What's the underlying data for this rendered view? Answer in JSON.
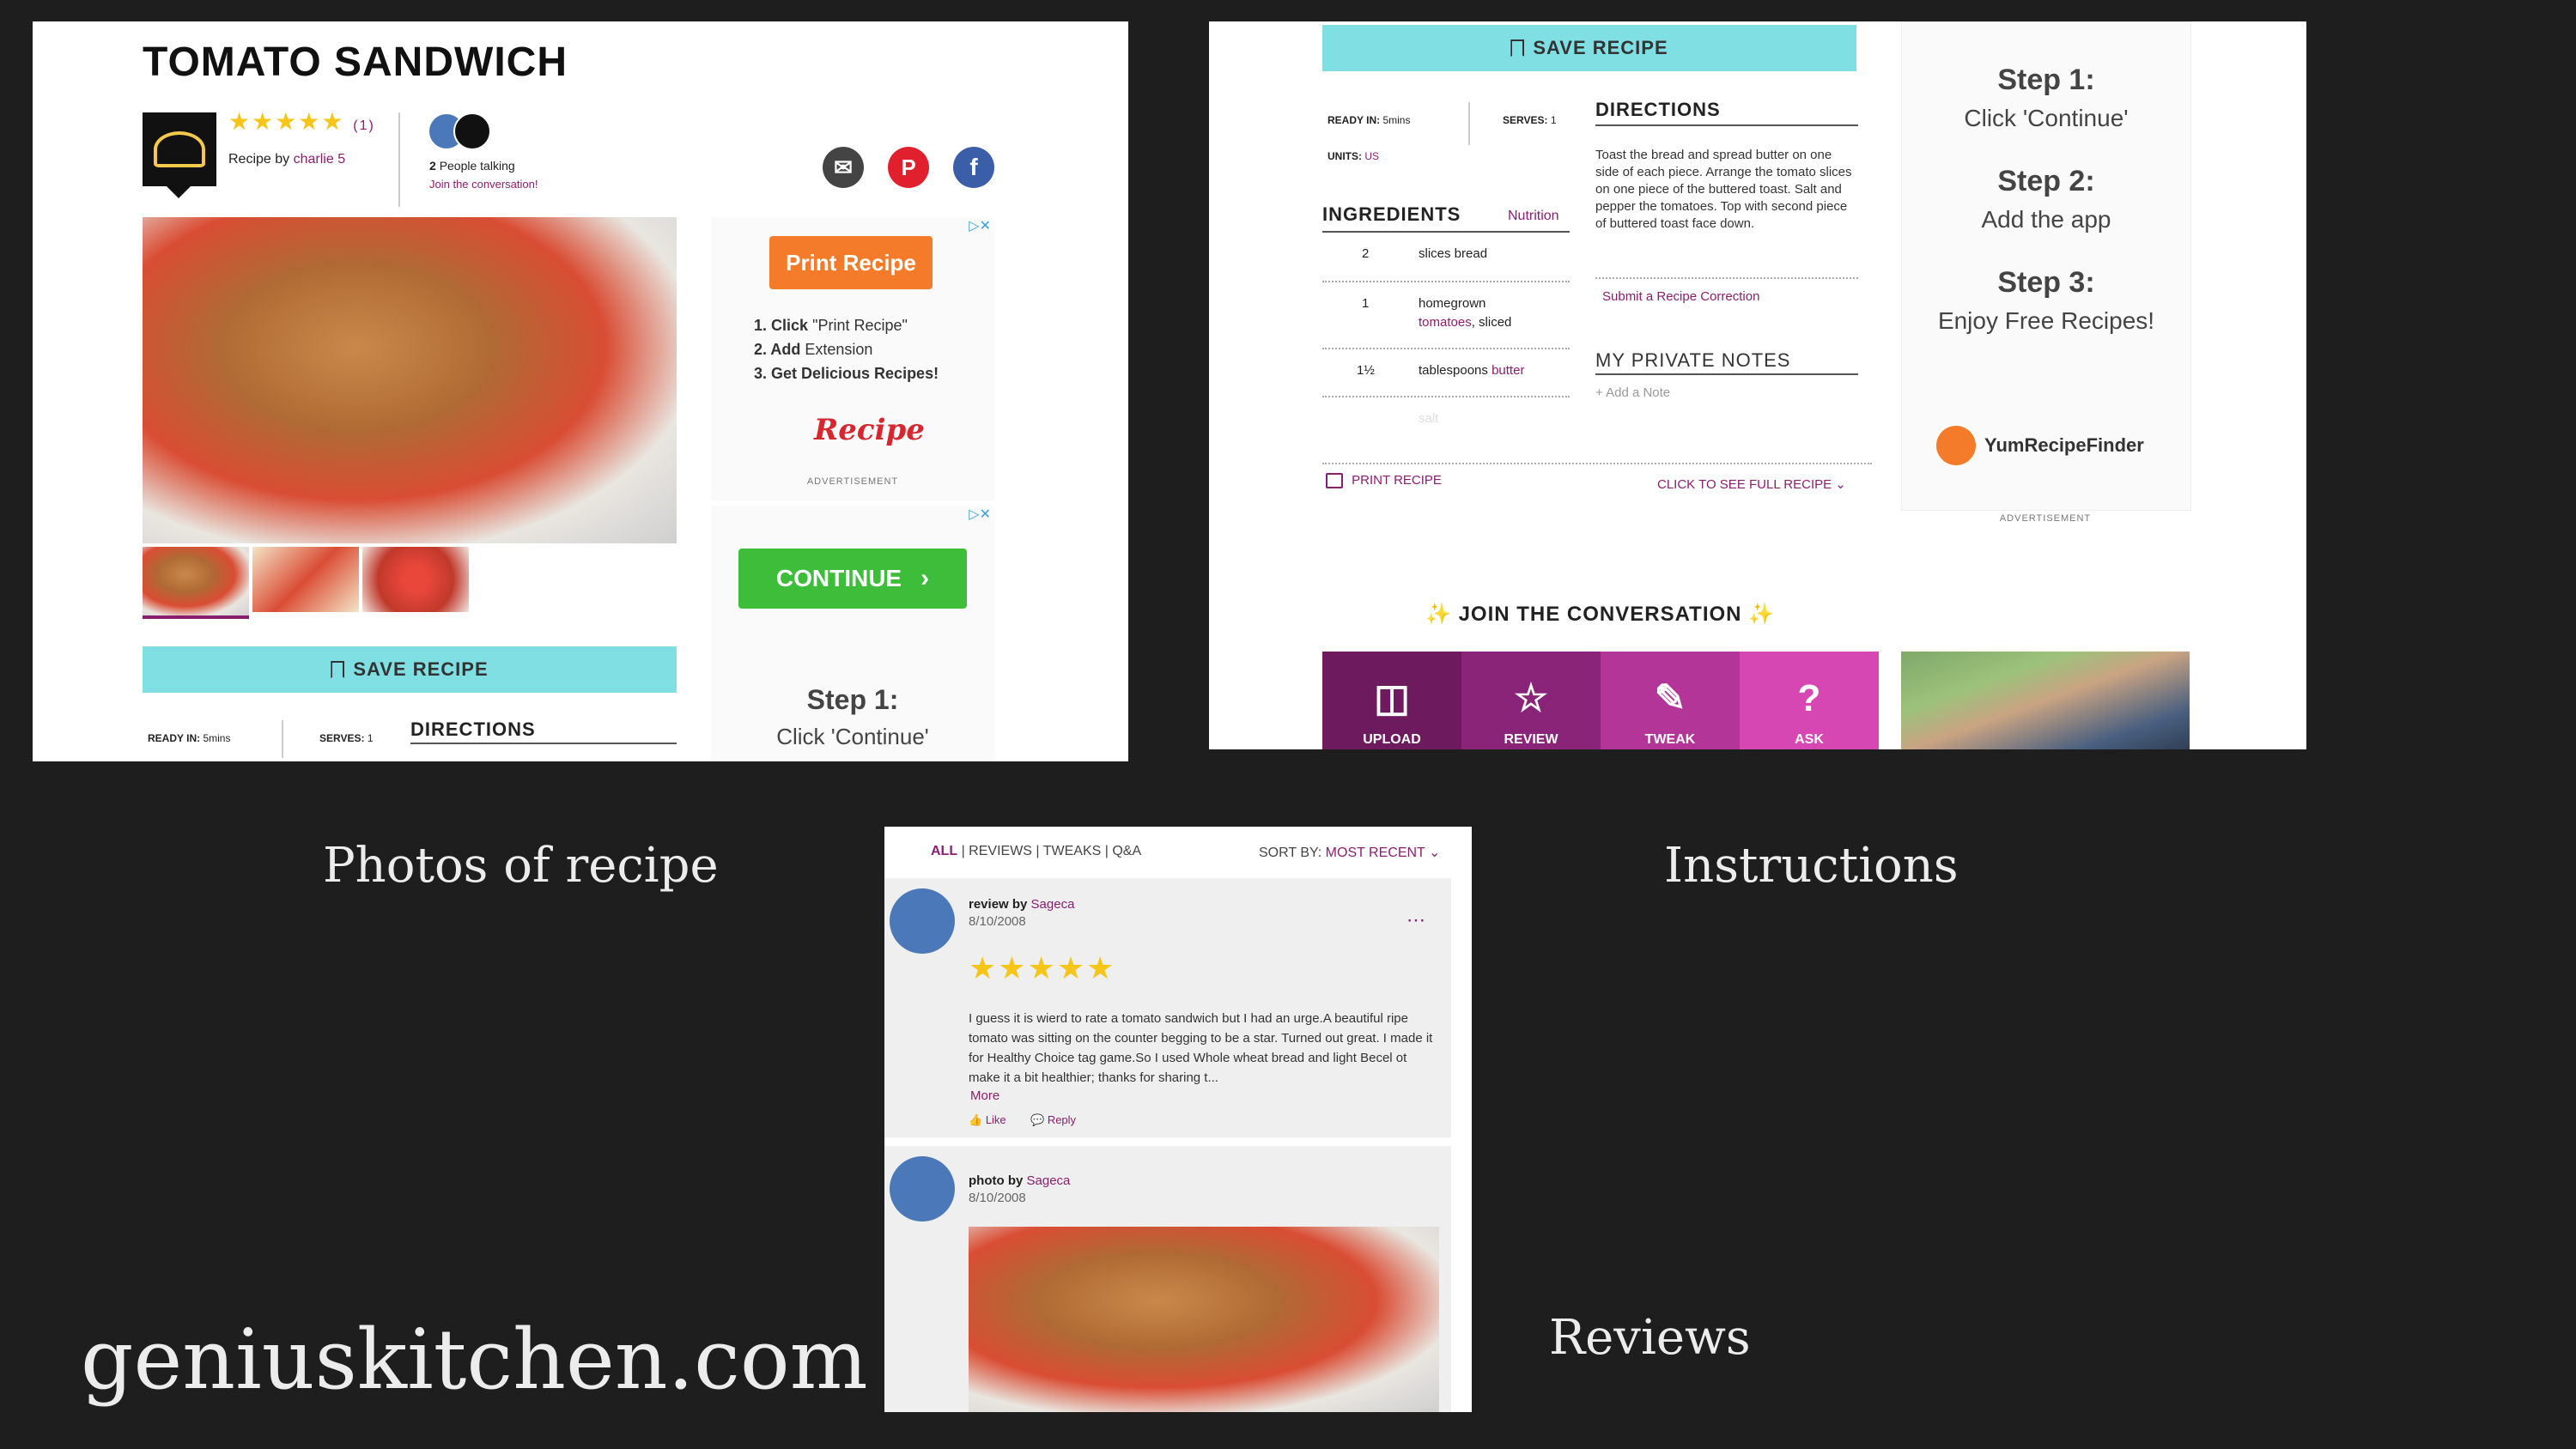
{
  "captions": {
    "photos": "Photos of recipe",
    "instructions": "Instructions",
    "reviews": "Reviews",
    "site": "geniuskitchen.com"
  },
  "panel1": {
    "title": "TOMATO SANDWICH",
    "rating_count": "(1)",
    "recipe_by_prefix": "Recipe by",
    "author": "charlie 5",
    "talking_count": "2",
    "talking_label": "People talking",
    "join_link": "Join the conversation!",
    "ad1": {
      "print_button": "Print Recipe",
      "step1_bold": "1. Click",
      "step1_rest": "\"Print Recipe\"",
      "step2_bold": "2. Add",
      "step2_rest": "Extension",
      "step3": "3. Get Delicious Recipes!",
      "logo_text": "Recipe",
      "advertisement": "ADVERTISEMENT"
    },
    "ad2": {
      "continue_button": "CONTINUE",
      "step_title": "Step 1:",
      "step_text": "Click 'Continue'"
    },
    "save_recipe": "SAVE RECIPE",
    "ready_in_label": "READY IN:",
    "ready_in_value": "5mins",
    "serves_label": "SERVES:",
    "serves_value": "1",
    "directions": "DIRECTIONS"
  },
  "panel2": {
    "save_recipe": "SAVE RECIPE",
    "ready_in_label": "READY IN:",
    "ready_in_value": "5mins",
    "serves_label": "SERVES:",
    "serves_value": "1",
    "units_label": "UNITS:",
    "units_value": "US",
    "ingredients": "INGREDIENTS",
    "nutrition": "Nutrition",
    "ingredient_rows": [
      {
        "qty": "2",
        "name": "slices bread",
        "link": ""
      },
      {
        "qty": "1",
        "name": "homegrown",
        "link": "tomatoes",
        "suffix": ", sliced"
      },
      {
        "qty": "1½",
        "name": "tablespoons",
        "link": "butter"
      },
      {
        "qty": "",
        "name": "salt",
        "link": ""
      }
    ],
    "directions": "DIRECTIONS",
    "directions_text": "Toast the bread and spread butter on one side of each piece. Arrange the tomato slices on one piece of the buttered toast. Salt and pepper the tomatoes. Top with second piece of buttered toast face down.",
    "submit_correction": "Submit a Recipe Correction",
    "private_notes": "MY PRIVATE NOTES",
    "add_note": "+ Add a Note",
    "print_recipe": "PRINT RECIPE",
    "see_full": "CLICK TO SEE FULL RECIPE",
    "side_ad": {
      "step1": "Step 1:",
      "step1_text": "Click 'Continue'",
      "step2": "Step 2:",
      "step2_text": "Add the app",
      "step3": "Step 3:",
      "step3_text": "Enjoy Free Recipes!",
      "brand": "YumRecipeFinder",
      "advertisement": "ADVERTISEMENT"
    },
    "join_conversation": "JOIN THE CONVERSATION",
    "tiles": [
      {
        "label": "UPLOAD",
        "icon": "camera-icon",
        "color": "#6e1a5e"
      },
      {
        "label": "REVIEW",
        "icon": "star-icon",
        "color": "#8a2478"
      },
      {
        "label": "TWEAK",
        "icon": "pencil-icon",
        "color": "#b23597"
      },
      {
        "label": "ASK",
        "icon": "question-icon",
        "color": "#d647b4"
      }
    ]
  },
  "panel3": {
    "filters": [
      "ALL",
      "REVIEWS",
      "TWEAKS",
      "Q&A"
    ],
    "sort_label": "SORT BY:",
    "sort_value": "MOST RECENT",
    "review": {
      "kind": "review by",
      "author": "Sageca",
      "date": "8/10/2008",
      "text": "I guess it is wierd to rate a tomato sandwich but I had an urge.A beautiful ripe tomato was sitting on the counter begging to be a star. Turned out great. I made it for Healthy Choice tag game.So I used Whole wheat bread and light Becel ot make it a bit healthier; thanks for sharing t...",
      "more": "More",
      "like": "Like",
      "reply": "Reply",
      "rating": 5
    },
    "photo": {
      "kind": "photo by",
      "author": "Sageca",
      "date": "8/10/2008"
    }
  },
  "colors": {
    "background": "#1e1e1e",
    "teal": "#7fdfe3",
    "purple": "#8a1e6e",
    "orange": "#f47b2a",
    "green": "#3dbd3a"
  }
}
